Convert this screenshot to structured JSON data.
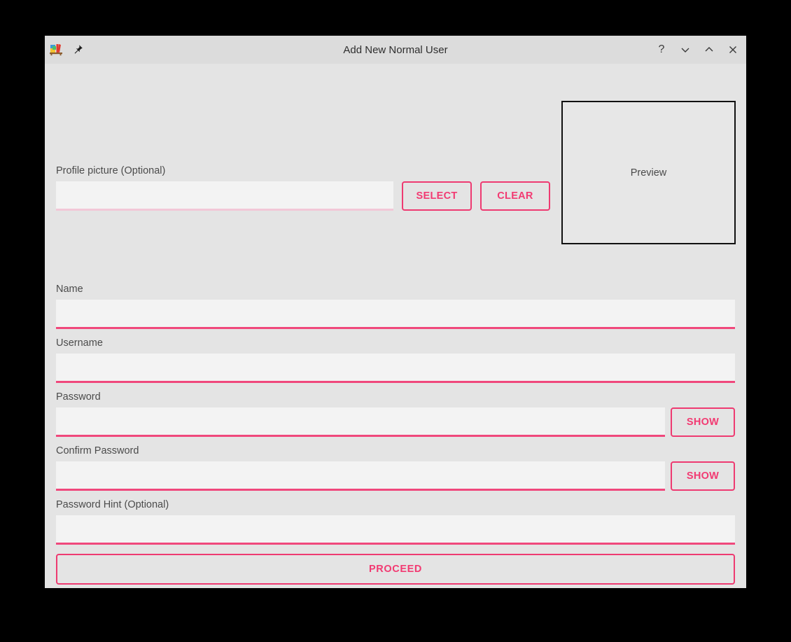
{
  "window": {
    "title": "Add New Normal User",
    "app_icon": "books-shelf-icon",
    "pin_icon": "pushpin-icon",
    "controls": [
      {
        "name": "help-button",
        "glyph": "?"
      },
      {
        "name": "shade-button",
        "glyph": "chevron-down"
      },
      {
        "name": "maximize-button",
        "glyph": "chevron-up"
      },
      {
        "name": "close-button",
        "glyph": "close"
      }
    ]
  },
  "colors": {
    "accent_pink": "#ee3a71",
    "accent_pink_text": "#f23a72",
    "underline_active": "#f0487c",
    "underline_disabled": "#f2c7d7",
    "window_background": "#e4e4e4",
    "titlebar_background": "#dcdcdc",
    "input_background": "#f3f3f3",
    "preview_border": "#111111",
    "desktop_background": "#000000"
  },
  "form": {
    "profile_picture": {
      "label": "Profile picture (Optional)",
      "value": "",
      "placeholder": "",
      "select_label": "SELECT",
      "clear_label": "CLEAR"
    },
    "preview": {
      "label": "Preview"
    },
    "name": {
      "label": "Name",
      "value": "",
      "placeholder": ""
    },
    "username": {
      "label": "Username",
      "value": "",
      "placeholder": ""
    },
    "password": {
      "label": "Password",
      "value": "",
      "placeholder": "",
      "show_label": "SHOW"
    },
    "confirm_password": {
      "label": "Confirm Password",
      "value": "",
      "placeholder": "",
      "show_label": "SHOW"
    },
    "password_hint": {
      "label": "Password Hint (Optional)",
      "value": "",
      "placeholder": ""
    },
    "proceed_label": "PROCEED"
  }
}
